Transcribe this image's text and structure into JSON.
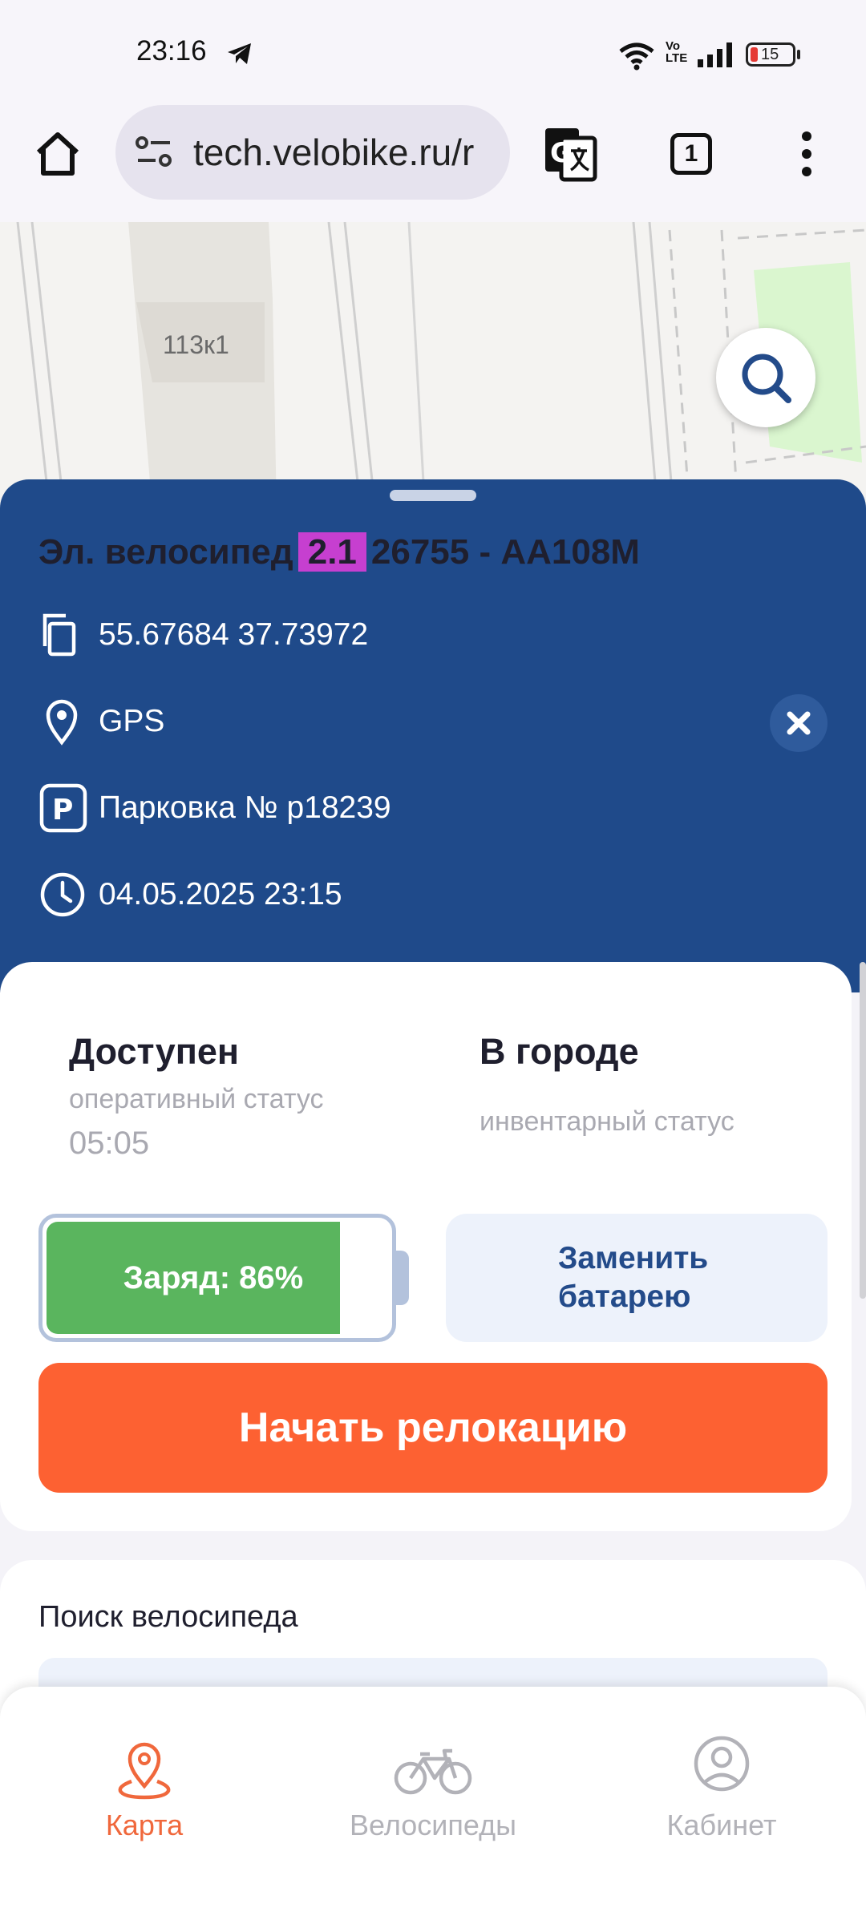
{
  "status_bar": {
    "time": "23:16",
    "battery_level": "15",
    "volte": "Vo\nLTE",
    "icons": [
      "telegram-icon",
      "wifi-icon",
      "volte-icon",
      "signal-icon",
      "battery-icon"
    ]
  },
  "browser": {
    "url": "tech.velobike.ru/r",
    "tabs_count": "1",
    "icons": [
      "home-icon",
      "site-settings-icon",
      "translate-icon",
      "tabs-icon",
      "more-vert-icon"
    ]
  },
  "map": {
    "building_label": "113к1",
    "search_icon": "search-icon"
  },
  "bike": {
    "type_label": "Эл. велосипед",
    "model": "2.1",
    "id": "26755 - AA108M",
    "coordinates": "55.67684 37.73972",
    "location_source": "GPS",
    "parking": "Парковка № p18239",
    "timestamp": "04.05.2025 23:15"
  },
  "status": {
    "operational_value": "Доступен",
    "operational_label": "оперативный статус",
    "operational_time": "05:05",
    "inventory_value": "В городе",
    "inventory_label": "инвентарный статус"
  },
  "battery": {
    "charge_text": "Заряд: 86%",
    "charge_fraction": 0.86,
    "replace_label": "Заменить батарею"
  },
  "actions": {
    "relocation_label": "Начать релокацию"
  },
  "search": {
    "title": "Поиск велосипеда"
  },
  "nav": {
    "items": [
      {
        "label": "Карта",
        "icon": "map-pin-icon",
        "active": true
      },
      {
        "label": "Велосипеды",
        "icon": "bike-icon",
        "active": false
      },
      {
        "label": "Кабинет",
        "icon": "user-circle-icon",
        "active": false
      }
    ]
  },
  "colors": {
    "panel_blue": "#1f4a8a",
    "model_badge": "#c63fd0",
    "accent_orange": "#fd6132",
    "charge_green": "#5ab55e",
    "nav_active": "#f0683c"
  }
}
